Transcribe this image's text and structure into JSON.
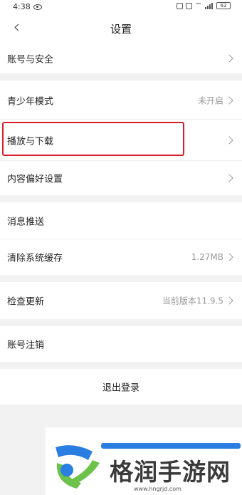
{
  "status_bar": {
    "time": "4:38",
    "battery": "62"
  },
  "header": {
    "title": "设置"
  },
  "settings": {
    "account_security": {
      "label": "账号与安全"
    },
    "teen_mode": {
      "label": "青少年模式",
      "value": "未开启"
    },
    "play_download": {
      "label": "播放与下载"
    },
    "content_pref": {
      "label": "内容偏好设置"
    },
    "notifications": {
      "label": "消息推送"
    },
    "clear_cache": {
      "label": "清除系统缓存",
      "value": "1.27MB"
    },
    "check_update": {
      "label": "检查更新",
      "value": "当前版本11.9.5"
    },
    "cancel_account": {
      "label": "账号注销"
    },
    "logout": {
      "label": "退出登录"
    }
  },
  "watermark": {
    "brand": "格润手游网",
    "url": "www.hngrjd.com"
  },
  "colors": {
    "highlight": "#d8202a",
    "brand_blue": "#2a7de1",
    "brand_green": "#6cc24a"
  }
}
